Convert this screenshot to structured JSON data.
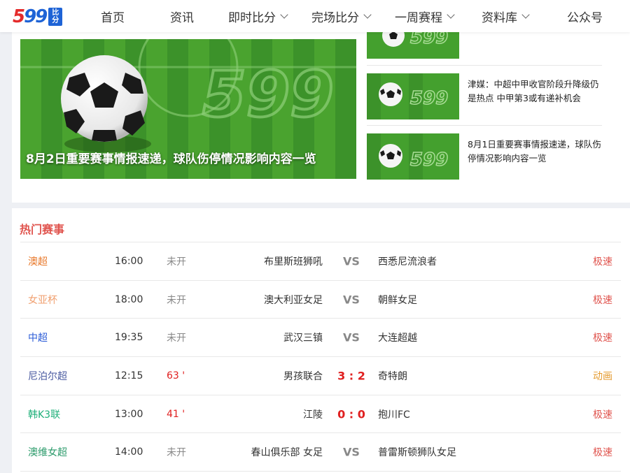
{
  "header": {
    "logo": {
      "num_a": "5",
      "num_b": "99",
      "tag": "比分"
    },
    "nav": [
      {
        "label": "首页",
        "dropdown": false
      },
      {
        "label": "资讯",
        "dropdown": false
      },
      {
        "label": "即时比分",
        "dropdown": true
      },
      {
        "label": "完场比分",
        "dropdown": true
      },
      {
        "label": "一周赛程",
        "dropdown": true
      },
      {
        "label": "资料库",
        "dropdown": true
      },
      {
        "label": "公众号",
        "dropdown": false
      }
    ]
  },
  "news": {
    "hero_caption": "8月2日重要赛事情报速递，球队伤停情况影响内容一览",
    "side": [
      {
        "title": ""
      },
      {
        "title": "津媒：中超中甲收官阶段升降级仍是热点 中甲第3或有递补机会"
      },
      {
        "title": "8月1日重要赛事情报速递，球队伤停情况影响内容一览"
      }
    ]
  },
  "hot": {
    "title": "热门赛事",
    "rows": [
      {
        "league": "澳超",
        "league_color": "#e8782a",
        "time": "16:00",
        "status": "未开",
        "home": "布里斯班狮吼",
        "score": "VS",
        "away": "西悉尼流浪者",
        "link": "极速"
      },
      {
        "league": "女亚杯",
        "league_color": "#f0a070",
        "time": "18:00",
        "status": "未开",
        "home": "澳大利亚女足",
        "score": "VS",
        "away": "朝鲜女足",
        "link": "极速"
      },
      {
        "league": "中超",
        "league_color": "#2a5bd7",
        "time": "19:35",
        "status": "未开",
        "home": "武汉三镇",
        "score": "VS",
        "away": "大连超越",
        "link": "极速"
      },
      {
        "league": "尼泊尔超",
        "league_color": "#4a5aa0",
        "time": "12:15",
        "status": "63 '",
        "home": "男孩联合",
        "score": "3 : 2",
        "away": "奇特朗",
        "link": "动画"
      },
      {
        "league": "韩K3联",
        "league_color": "#1fb07a",
        "time": "13:00",
        "status": "41 '",
        "home": "江陵",
        "score": "0 : 0",
        "away": "抱川FC",
        "link": "极速"
      },
      {
        "league": "澳维女超",
        "league_color": "#2a9a6a",
        "time": "14:00",
        "status": "未开",
        "home": "春山俱乐部 女足",
        "score": "VS",
        "away": "普雷斯顿狮队女足",
        "link": "极速"
      }
    ]
  },
  "colors": {
    "accent": "#e0554f",
    "live": "#e02020",
    "grass": "#3f9b2a"
  }
}
